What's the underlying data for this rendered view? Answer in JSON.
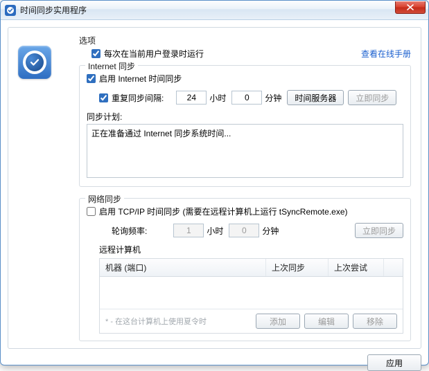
{
  "window": {
    "title": "时间同步实用程序"
  },
  "options": {
    "section_label": "选项",
    "run_on_login_label": "每次在当前用户登录时运行",
    "online_manual_link": "查看在线手册"
  },
  "internet_sync": {
    "legend": "Internet 同步",
    "enable_label": "启用 Internet 时间同步",
    "repeat_label": "重复同步间隔:",
    "hours_value": "24",
    "hours_unit": "小时",
    "minutes_value": "0",
    "minutes_unit": "分钟",
    "time_server_btn": "时间服务器",
    "sync_now_btn": "立即同步",
    "plan_label": "同步计划:",
    "plan_text": "正在准备通过 Internet 同步系统时间..."
  },
  "network_sync": {
    "legend": "网络同步",
    "enable_label": "启用 TCP/IP 时间同步 (需要在远程计算机上运行 tSyncRemote.exe)",
    "poll_label": "轮询频率:",
    "hours_value": "1",
    "hours_unit": "小时",
    "minutes_value": "0",
    "minutes_unit": "分钟",
    "sync_now_btn": "立即同步",
    "remote_label": "远程计算机",
    "columns": {
      "machine": "机器 (端口)",
      "last_sync": "上次同步",
      "last_attempt": "上次尝试"
    },
    "dst_note": "* - 在这台计算机上使用夏令时",
    "add_btn": "添加",
    "edit_btn": "编辑",
    "remove_btn": "移除"
  },
  "footer": {
    "apply_btn": "应用"
  }
}
